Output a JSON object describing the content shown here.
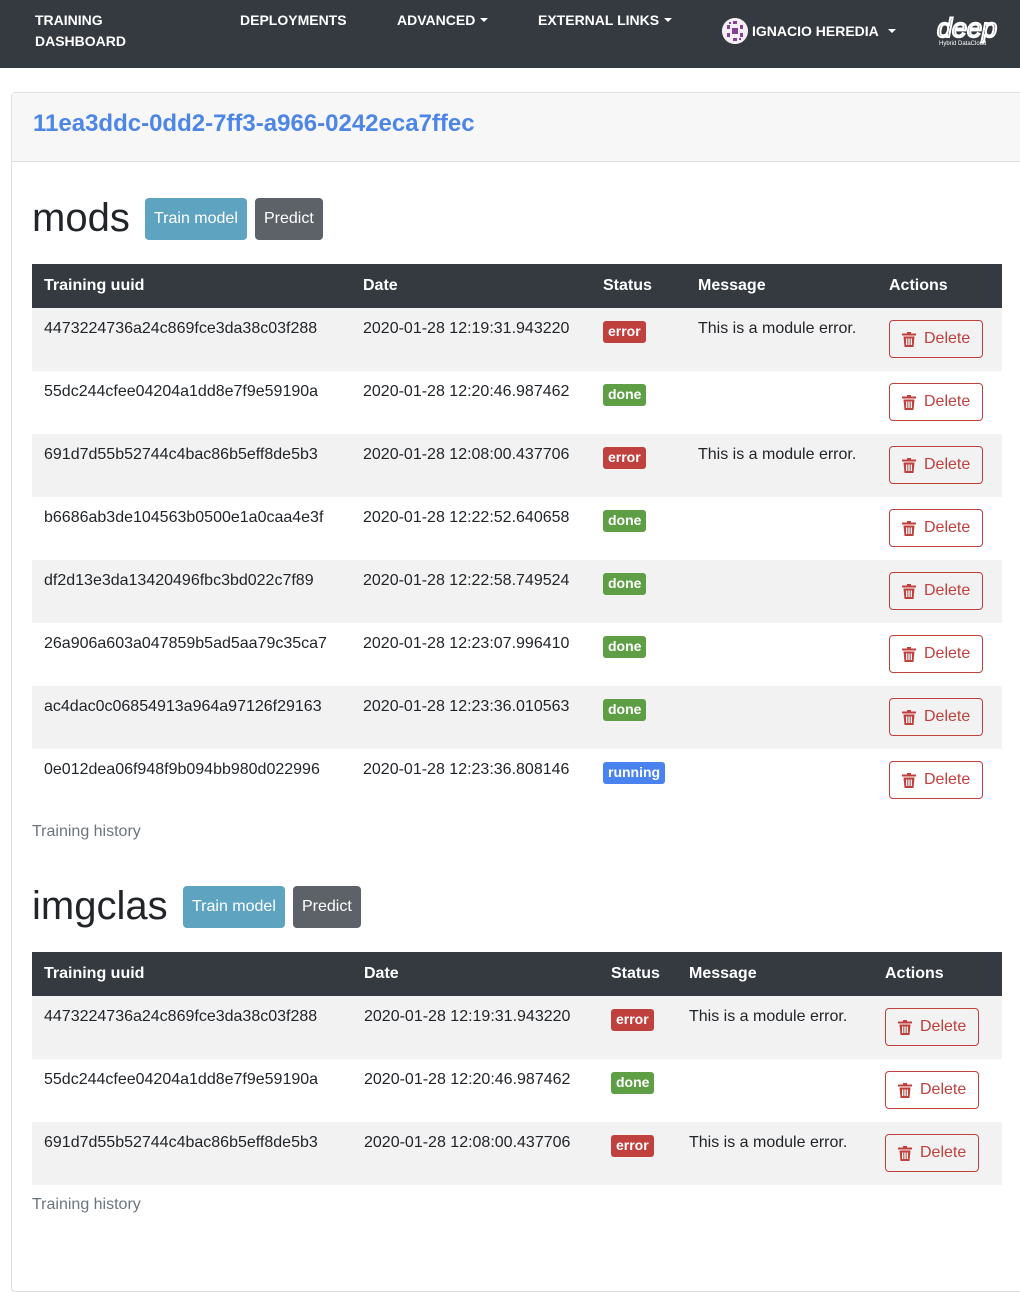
{
  "nav": {
    "brand": "TRAINING DASHBOARD",
    "deployments": "DEPLOYMENTS",
    "advanced": "ADVANCED",
    "external_links": "EXTERNAL LINKS",
    "user": "IGNACIO HEREDIA",
    "logo_text": "deep",
    "logo_subtitle": "Hybrid DataCloud"
  },
  "card": {
    "title": "11ea3ddc-0dd2-7ff3-a966-0242eca7ffec"
  },
  "columns": [
    "Training uuid",
    "Date",
    "Status",
    "Message",
    "Actions"
  ],
  "modules": [
    {
      "name": "mods",
      "train_label": "Train model",
      "predict_label": "Predict",
      "history_label": "Training history",
      "rows": [
        {
          "uuid": "4473224736a24c869fce3da38c03f288",
          "date": "2020-01-28 12:19:31.943220",
          "status": "error",
          "message": "This is a module error.",
          "action": "Delete"
        },
        {
          "uuid": "55dc244cfee04204a1dd8e7f9e59190a",
          "date": "2020-01-28 12:20:46.987462",
          "status": "done",
          "message": "",
          "action": "Delete"
        },
        {
          "uuid": "691d7d55b52744c4bac86b5eff8de5b3",
          "date": "2020-01-28 12:08:00.437706",
          "status": "error",
          "message": "This is a module error.",
          "action": "Delete"
        },
        {
          "uuid": "b6686ab3de104563b0500e1a0caa4e3f",
          "date": "2020-01-28 12:22:52.640658",
          "status": "done",
          "message": "",
          "action": "Delete"
        },
        {
          "uuid": "df2d13e3da13420496fbc3bd022c7f89",
          "date": "2020-01-28 12:22:58.749524",
          "status": "done",
          "message": "",
          "action": "Delete"
        },
        {
          "uuid": "26a906a603a047859b5ad5aa79c35ca7",
          "date": "2020-01-28 12:23:07.996410",
          "status": "done",
          "message": "",
          "action": "Delete"
        },
        {
          "uuid": "ac4dac0c06854913a964a97126f29163",
          "date": "2020-01-28 12:23:36.010563",
          "status": "done",
          "message": "",
          "action": "Delete"
        },
        {
          "uuid": "0e012dea06f948f9b094bb980d022996",
          "date": "2020-01-28 12:23:36.808146",
          "status": "running",
          "message": "",
          "action": "Delete"
        }
      ]
    },
    {
      "name": "imgclas",
      "train_label": "Train model",
      "predict_label": "Predict",
      "history_label": "Training history",
      "rows": [
        {
          "uuid": "4473224736a24c869fce3da38c03f288",
          "date": "2020-01-28 12:19:31.943220",
          "status": "error",
          "message": "This is a module error.",
          "action": "Delete"
        },
        {
          "uuid": "55dc244cfee04204a1dd8e7f9e59190a",
          "date": "2020-01-28 12:20:46.987462",
          "status": "done",
          "message": "",
          "action": "Delete"
        },
        {
          "uuid": "691d7d55b52744c4bac86b5eff8de5b3",
          "date": "2020-01-28 12:08:00.437706",
          "status": "error",
          "message": "This is a module error.",
          "action": "Delete"
        }
      ]
    }
  ],
  "colors": {
    "navbar": "#343a40",
    "link": "#4d86e6",
    "error": "#c0403e",
    "done": "#5e9f45",
    "running": "#4a83ef",
    "train_button": "#5ea3bf",
    "predict_button": "#5d6268"
  }
}
